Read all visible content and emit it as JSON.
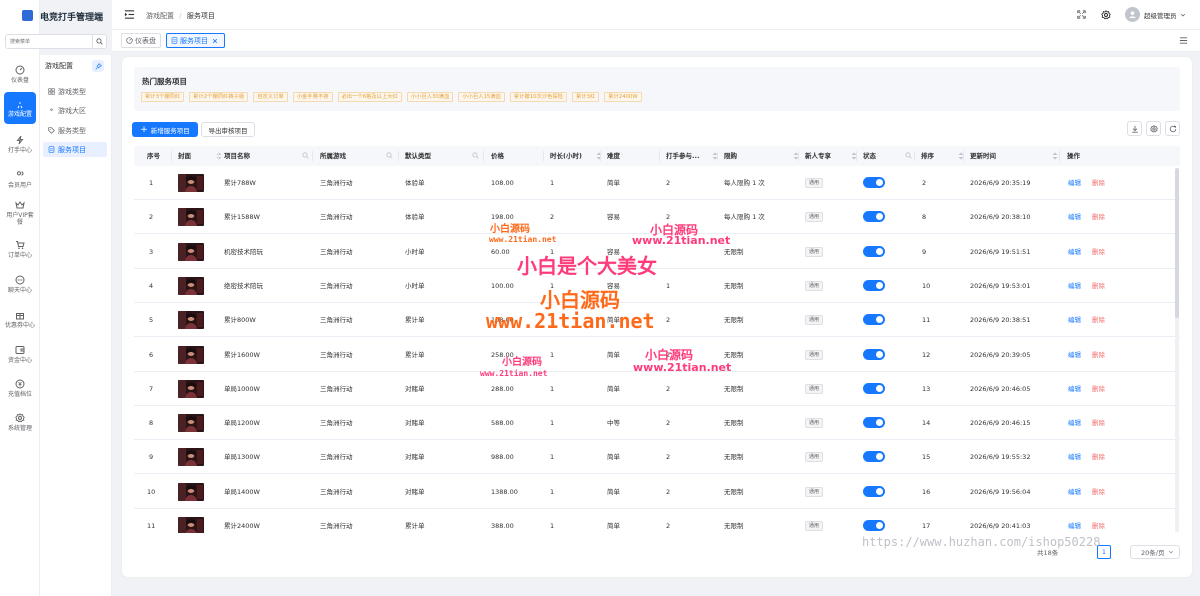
{
  "app": {
    "title": "电竞打手管理端"
  },
  "sidebar": {
    "search_placeholder": "搜索菜单",
    "items": [
      {
        "label": "仪表盘",
        "icon": "dashboard-icon",
        "active": false
      },
      {
        "label": "游戏配置",
        "icon": "rocket-icon",
        "active": true
      },
      {
        "label": "打手中心",
        "icon": "lightning-icon",
        "active": false
      },
      {
        "label": "会员用户",
        "icon": "users-icon",
        "active": false
      },
      {
        "label": "用户VIP套餐",
        "icon": "vip-icon",
        "active": false
      },
      {
        "label": "订单中心",
        "icon": "cart-icon",
        "active": false
      },
      {
        "label": "聊天中心",
        "icon": "chat-icon",
        "active": false
      },
      {
        "label": "优惠券中心",
        "icon": "gift-icon",
        "active": false
      },
      {
        "label": "资金中心",
        "icon": "wallet-icon",
        "active": false
      },
      {
        "label": "充值档位",
        "icon": "coin-icon",
        "active": false
      },
      {
        "label": "系统管理",
        "icon": "gear-icon",
        "active": false
      }
    ]
  },
  "submenu": {
    "title": "游戏配置",
    "items": [
      {
        "label": "游戏类型",
        "icon": "grid-icon",
        "active": false
      },
      {
        "label": "游戏大区",
        "icon": "location-icon",
        "active": false
      },
      {
        "label": "服务类型",
        "icon": "tag-icon",
        "active": false
      },
      {
        "label": "服务项目",
        "icon": "document-icon",
        "active": true
      }
    ]
  },
  "header": {
    "breadcrumb": [
      "游戏配置",
      "服务项目"
    ],
    "user": "超级管理员"
  },
  "tabs": [
    {
      "label": "仪表盘",
      "active": false
    },
    {
      "label": "服务项目",
      "active": true
    }
  ],
  "hot": {
    "title": "热门服务项目",
    "tags": [
      "累计3个棚同红",
      "累计2个棚同红裤子版",
      "自定义订单",
      "小金手赛不夜",
      "必出一个6格及以上大红",
      "小小巨人30满血",
      "小小巨人15满血",
      "累计撤10次沙色探险",
      "累计3红",
      "累计2400W"
    ]
  },
  "toolbar": {
    "add_label": "新增服务项目",
    "export_label": "导出审核项目"
  },
  "table": {
    "columns": [
      "序号",
      "封面",
      "项目名称",
      "所属游戏",
      "默认类型",
      "价格",
      "时长(小时)",
      "难度",
      "打手参与...",
      "限购",
      "新人专享",
      "状态",
      "排序",
      "更新时间",
      "操作"
    ],
    "rows": [
      {
        "no": "1",
        "name": "累计788W",
        "game": "三角洲行动",
        "type": "体验单",
        "price": "108.00",
        "duration": "1",
        "difficulty": "简单",
        "players": "2",
        "limit": "每人限购 1 次",
        "newbie": "通用",
        "sort": "2",
        "updated": "2026/6/9 20:35:19"
      },
      {
        "no": "2",
        "name": "累计1588W",
        "game": "三角洲行动",
        "type": "体验单",
        "price": "198.00",
        "duration": "2",
        "difficulty": "容易",
        "players": "2",
        "limit": "每人限购 1 次",
        "newbie": "通用",
        "sort": "8",
        "updated": "2026/6/9 20:38:10"
      },
      {
        "no": "3",
        "name": "机密技术陪玩",
        "game": "三角洲行动",
        "type": "小时单",
        "price": "60.00",
        "duration": "1",
        "difficulty": "容易",
        "players": "",
        "limit": "无限制",
        "newbie": "通用",
        "sort": "9",
        "updated": "2026/6/9 19:51:51"
      },
      {
        "no": "4",
        "name": "绝密技术陪玩",
        "game": "三角洲行动",
        "type": "小时单",
        "price": "100.00",
        "duration": "1",
        "difficulty": "容易",
        "players": "1",
        "limit": "无限制",
        "newbie": "通用",
        "sort": "10",
        "updated": "2026/6/9 19:53:01"
      },
      {
        "no": "5",
        "name": "累计800W",
        "game": "三角洲行动",
        "type": "累计单",
        "price": "108.00",
        "duration": "1",
        "difficulty": "简单",
        "players": "2",
        "limit": "无限制",
        "newbie": "通用",
        "sort": "11",
        "updated": "2026/6/9 20:38:51"
      },
      {
        "no": "6",
        "name": "累计1600W",
        "game": "三角洲行动",
        "type": "累计单",
        "price": "258.00",
        "duration": "1",
        "difficulty": "简单",
        "players": "2",
        "limit": "无限制",
        "newbie": "通用",
        "sort": "12",
        "updated": "2026/6/9 20:39:05"
      },
      {
        "no": "7",
        "name": "单局1000W",
        "game": "三角洲行动",
        "type": "对赌单",
        "price": "288.00",
        "duration": "1",
        "difficulty": "简单",
        "players": "2",
        "limit": "无限制",
        "newbie": "通用",
        "sort": "13",
        "updated": "2026/6/9 20:46:05"
      },
      {
        "no": "8",
        "name": "单局1200W",
        "game": "三角洲行动",
        "type": "对赌单",
        "price": "588.00",
        "duration": "1",
        "difficulty": "中等",
        "players": "2",
        "limit": "无限制",
        "newbie": "通用",
        "sort": "14",
        "updated": "2026/6/9 20:46:15"
      },
      {
        "no": "9",
        "name": "单局1300W",
        "game": "三角洲行动",
        "type": "对赌单",
        "price": "988.00",
        "duration": "1",
        "difficulty": "简单",
        "players": "2",
        "limit": "无限制",
        "newbie": "通用",
        "sort": "15",
        "updated": "2026/6/9 19:55:32"
      },
      {
        "no": "10",
        "name": "单局1400W",
        "game": "三角洲行动",
        "type": "对赌单",
        "price": "1388.00",
        "duration": "1",
        "difficulty": "简单",
        "players": "2",
        "limit": "无限制",
        "newbie": "通用",
        "sort": "16",
        "updated": "2026/6/9 19:56:04"
      },
      {
        "no": "11",
        "name": "累计2400W",
        "game": "三角洲行动",
        "type": "累计单",
        "price": "388.00",
        "duration": "1",
        "difficulty": "简单",
        "players": "2",
        "limit": "无限制",
        "newbie": "通用",
        "sort": "17",
        "updated": "2026/6/9 20:41:03"
      }
    ],
    "action_edit": "编辑",
    "action_delete": "删除"
  },
  "pagination": {
    "total": "共18条",
    "page": "1",
    "page_size": "20条/页"
  },
  "watermarks": [
    {
      "text": "小白源码"
    },
    {
      "text": "www.21tian.net"
    },
    {
      "text": "小白源码"
    },
    {
      "text": "www.21tian.net"
    },
    {
      "text": "小白是个大美女"
    },
    {
      "text": "小白源码"
    },
    {
      "text": "www.21tian.net"
    },
    {
      "text": "小白源码"
    },
    {
      "text": "www.21tian.net"
    },
    {
      "text": "小白源码"
    },
    {
      "text": "www.21tian.net"
    },
    {
      "text": "https://www.huzhan.com/ishop50228"
    }
  ],
  "colors": {
    "primary": "#1677ff",
    "danger": "#f56c6c",
    "tag": "#e6a23c",
    "watermark": "#ff6a1a"
  }
}
